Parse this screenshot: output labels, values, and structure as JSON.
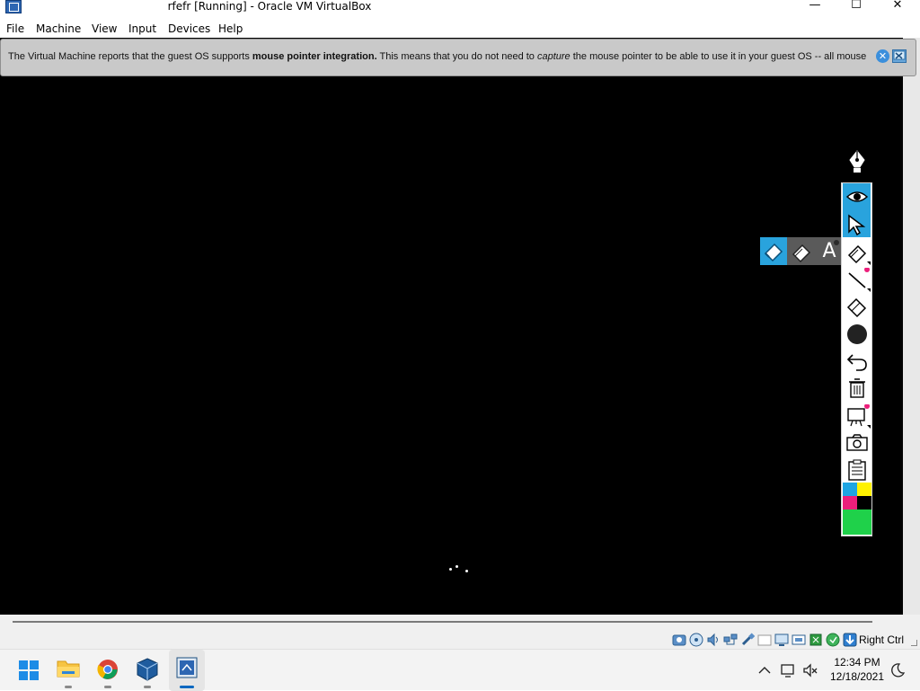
{
  "window": {
    "title": "rfefr [Running] - Oracle VM VirtualBox",
    "minimize_glyph": "—",
    "maximize_glyph": "☐",
    "close_glyph": "✕"
  },
  "menu": {
    "items": [
      {
        "label": "File"
      },
      {
        "label": "Machine"
      },
      {
        "label": "View"
      },
      {
        "label": "Input"
      },
      {
        "label": "Devices"
      },
      {
        "label": "Help"
      }
    ]
  },
  "notification": {
    "text_before": "The Virtual Machine reports that the guest OS supports ",
    "bold": "mouse pointer integration.",
    "text_middle": " This means that you do not need to ",
    "italic": "capture",
    "text_after": " the mouse pointer to be able to use it in your guest OS -- all mouse",
    "close_glyph": "✕"
  },
  "drawing_toolbar": {
    "tools": [
      {
        "name": "eye",
        "active": true
      },
      {
        "name": "arrow-pointer",
        "active": true
      },
      {
        "name": "highlighter",
        "active": false
      },
      {
        "name": "line",
        "active": false
      },
      {
        "name": "eraser",
        "active": false
      },
      {
        "name": "circle-brush",
        "active": false
      },
      {
        "name": "undo",
        "active": false
      },
      {
        "name": "trash",
        "active": false
      },
      {
        "name": "whiteboard",
        "active": false
      },
      {
        "name": "camera",
        "active": false
      },
      {
        "name": "clipboard",
        "active": false
      }
    ],
    "flyout": {
      "letter": "A"
    },
    "colors": {
      "cyan": "#1ea5e3",
      "yellow": "#fff200",
      "magenta": "#ec1f7b",
      "black": "#000000",
      "green": "#1fd14a"
    }
  },
  "status": {
    "host_key": "Right Ctrl"
  },
  "taskbar": {
    "apps": [
      "start",
      "file-explorer",
      "chrome",
      "virtualbox",
      "windows-10-vm"
    ],
    "time": "12:34 PM",
    "date": "12/18/2021"
  }
}
